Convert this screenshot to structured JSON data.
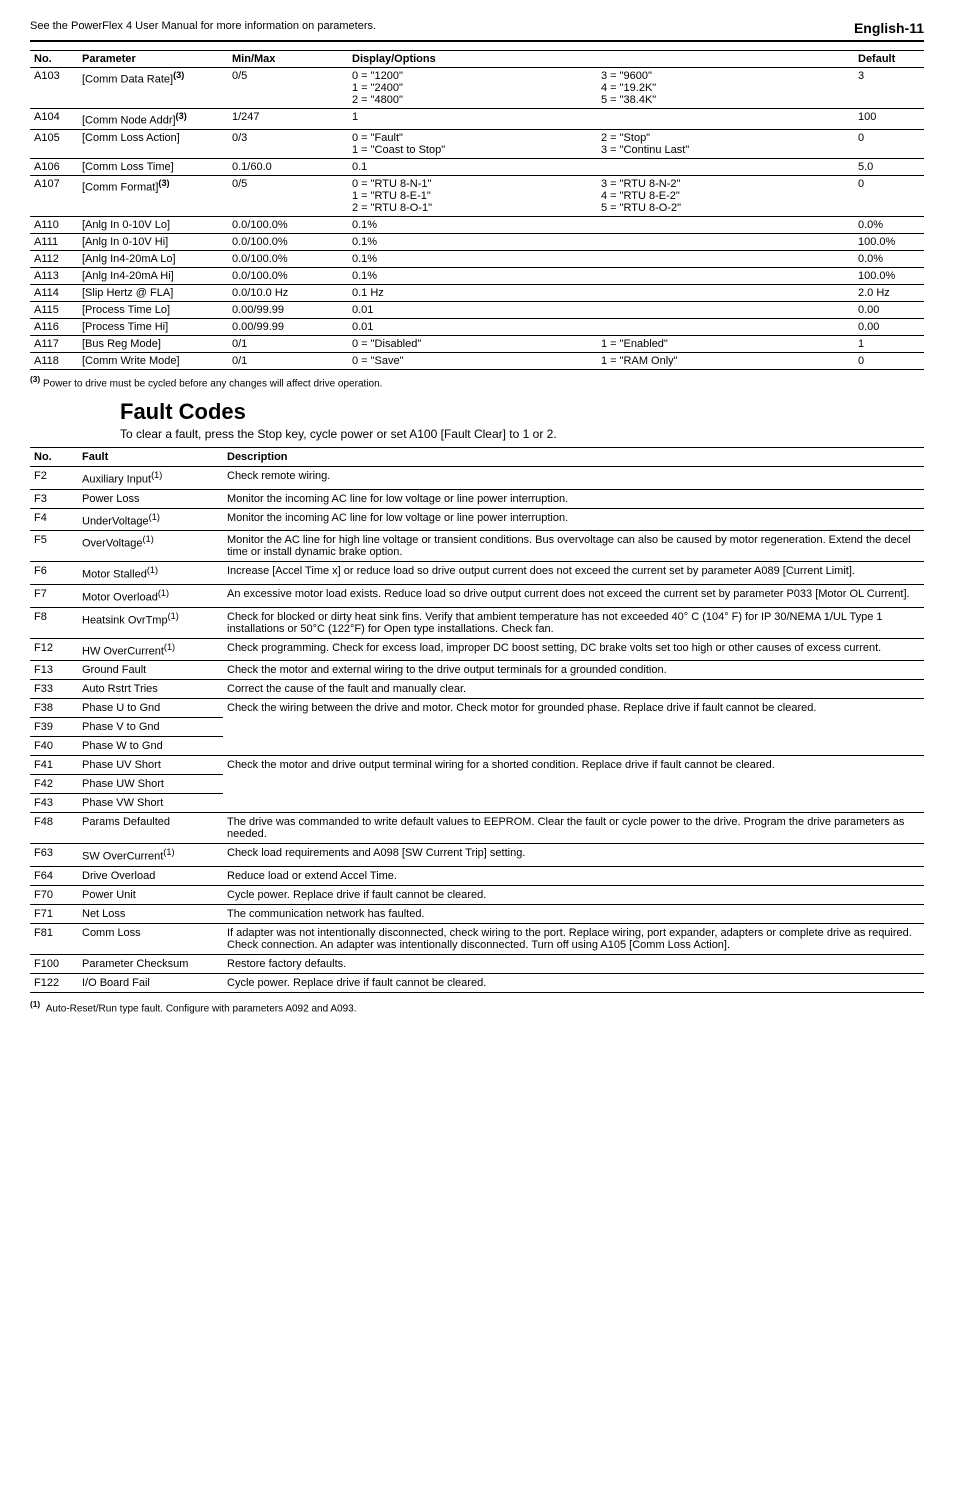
{
  "header": {
    "note": "See the PowerFlex 4 User Manual for more information on parameters.",
    "page": "English-11"
  },
  "param_headers": [
    "No.",
    "Parameter",
    "Min/Max",
    "Display/Options",
    "Default"
  ],
  "params": [
    {
      "no": "A103",
      "name": "[Comm Data Rate]",
      "sup": "(3)",
      "minmax": "0/5",
      "opts1": [
        "0 = \"1200\"",
        "1 = \"2400\"",
        "2 = \"4800\""
      ],
      "opts2": [
        "3 = \"9600\"",
        "4 = \"19.2K\"",
        "5 = \"38.4K\""
      ],
      "def": "3"
    },
    {
      "no": "A104",
      "name": "[Comm Node Addr]",
      "sup": "(3)",
      "minmax": "1/247",
      "opts1": [
        "1"
      ],
      "opts2": [],
      "def": "100"
    },
    {
      "no": "A105",
      "name": "[Comm Loss Action]",
      "sup": "",
      "minmax": "0/3",
      "opts1": [
        "0 = \"Fault\"",
        "1 = \"Coast to Stop\""
      ],
      "opts2": [
        "2 = \"Stop\"",
        "3 = \"Continu Last\""
      ],
      "def": "0"
    },
    {
      "no": "A106",
      "name": "[Comm Loss Time]",
      "sup": "",
      "minmax": "0.1/60.0",
      "opts1": [
        "0.1"
      ],
      "opts2": [],
      "def": "5.0"
    },
    {
      "no": "A107",
      "name": "[Comm Format]",
      "sup": "(3)",
      "minmax": "0/5",
      "opts1": [
        "0 = \"RTU 8-N-1\"",
        "1 = \"RTU 8-E-1\"",
        "2 = \"RTU 8-O-1\""
      ],
      "opts2": [
        "3 = \"RTU 8-N-2\"",
        "4 = \"RTU 8-E-2\"",
        "5 = \"RTU 8-O-2\""
      ],
      "def": "0"
    },
    {
      "no": "A110",
      "name": "[Anlg In 0-10V Lo]",
      "sup": "",
      "minmax": "0.0/100.0%",
      "opts1": [
        "0.1%"
      ],
      "opts2": [],
      "def": "0.0%"
    },
    {
      "no": "A111",
      "name": "[Anlg In 0-10V Hi]",
      "sup": "",
      "minmax": "0.0/100.0%",
      "opts1": [
        "0.1%"
      ],
      "opts2": [],
      "def": "100.0%"
    },
    {
      "no": "A112",
      "name": "[Anlg In4-20mA Lo]",
      "sup": "",
      "minmax": "0.0/100.0%",
      "opts1": [
        "0.1%"
      ],
      "opts2": [],
      "def": "0.0%"
    },
    {
      "no": "A113",
      "name": "[Anlg In4-20mA Hi]",
      "sup": "",
      "minmax": "0.0/100.0%",
      "opts1": [
        "0.1%"
      ],
      "opts2": [],
      "def": "100.0%"
    },
    {
      "no": "A114",
      "name": "[Slip Hertz @ FLA]",
      "sup": "",
      "minmax": "0.0/10.0 Hz",
      "opts1": [
        "0.1 Hz"
      ],
      "opts2": [],
      "def": "2.0 Hz"
    },
    {
      "no": "A115",
      "name": "[Process Time Lo]",
      "sup": "",
      "minmax": "0.00/99.99",
      "opts1": [
        "0.01"
      ],
      "opts2": [],
      "def": "0.00"
    },
    {
      "no": "A116",
      "name": "[Process Time Hi]",
      "sup": "",
      "minmax": "0.00/99.99",
      "opts1": [
        "0.01"
      ],
      "opts2": [],
      "def": "0.00"
    },
    {
      "no": "A117",
      "name": "[Bus Reg Mode]",
      "sup": "",
      "minmax": "0/1",
      "opts1": [
        "0 = \"Disabled\""
      ],
      "opts2": [
        "1 = \"Enabled\""
      ],
      "def": "1"
    },
    {
      "no": "A118",
      "name": "[Comm Write Mode]",
      "sup": "",
      "minmax": "0/1",
      "opts1": [
        "0 = \"Save\""
      ],
      "opts2": [
        "1 = \"RAM Only\""
      ],
      "def": "0"
    }
  ],
  "param_footnote_sup": "(3)",
  "param_footnote": " Power to drive must be cycled before any changes will affect drive operation.",
  "fault_section": {
    "title": "Fault Codes",
    "sub": "To clear a fault, press the Stop key, cycle power or set A100 [Fault Clear] to 1 or 2."
  },
  "fault_headers": [
    "No.",
    "Fault",
    "Description"
  ],
  "faults": [
    {
      "no": "F2",
      "name": "Auxiliary Input",
      "sup": "(1)",
      "desc": "Check remote wiring."
    },
    {
      "no": "F3",
      "name": "Power Loss",
      "sup": "",
      "desc": "Monitor the incoming AC line for low voltage or line power interruption."
    },
    {
      "no": "F4",
      "name": "UnderVoltage",
      "sup": "(1)",
      "desc": "Monitor the incoming AC line for low voltage or line power interruption."
    },
    {
      "no": "F5",
      "name": "OverVoltage",
      "sup": "(1)",
      "desc": "Monitor the AC line for high line voltage or transient conditions. Bus overvoltage can also be caused by motor regeneration. Extend the decel time or install dynamic brake option."
    },
    {
      "no": "F6",
      "name": "Motor Stalled",
      "sup": "(1)",
      "desc": "Increase [Accel Time x] or reduce load so drive output current does not exceed the current set by parameter A089 [Current Limit]."
    },
    {
      "no": "F7",
      "name": "Motor Overload",
      "sup": "(1)",
      "desc": "An excessive motor load exists. Reduce load so drive output current does not exceed the current set by parameter P033 [Motor OL Current]."
    },
    {
      "no": "F8",
      "name": "Heatsink OvrTmp",
      "sup": "(1)",
      "desc": "Check for blocked or dirty heat sink fins. Verify that ambient temperature has not exceeded 40° C (104° F) for IP 30/NEMA 1/UL Type 1 installations or 50°C (122°F) for Open type installations. Check fan."
    },
    {
      "no": "F12",
      "name": "HW OverCurrent",
      "sup": "(1)",
      "desc": "Check programming. Check for excess load, improper DC boost setting, DC brake volts set too high or other causes of excess current."
    },
    {
      "no": "F13",
      "name": "Ground Fault",
      "sup": "",
      "desc": "Check the motor and external wiring to the drive output terminals for a grounded condition."
    },
    {
      "no": "F33",
      "name": "Auto Rstrt Tries",
      "sup": "",
      "desc": "Correct the cause of the fault and manually clear."
    },
    {
      "no": "F38",
      "name": "Phase U to Gnd",
      "sup": "",
      "desc": "Check the wiring between the drive and motor. Check motor for grounded phase. Replace drive if fault cannot be cleared.",
      "rowspan": 3
    },
    {
      "no": "F39",
      "name": "Phase V to Gnd",
      "sup": "",
      "merge": true
    },
    {
      "no": "F40",
      "name": "Phase W to Gnd",
      "sup": "",
      "merge": true
    },
    {
      "no": "F41",
      "name": "Phase UV Short",
      "sup": "",
      "desc": "Check the motor and drive output terminal wiring for a shorted condition. Replace drive if fault cannot be cleared.",
      "rowspan": 3
    },
    {
      "no": "F42",
      "name": "Phase UW Short",
      "sup": "",
      "merge": true
    },
    {
      "no": "F43",
      "name": "Phase VW Short",
      "sup": "",
      "merge": true
    },
    {
      "no": "F48",
      "name": "Params Defaulted",
      "sup": "",
      "desc": "The drive was commanded to write default values to EEPROM. Clear the fault or cycle power to the drive. Program the drive parameters as needed."
    },
    {
      "no": "F63",
      "name": "SW OverCurrent",
      "sup": "(1)",
      "desc": "Check load requirements and A098 [SW Current Trip] setting."
    },
    {
      "no": "F64",
      "name": "Drive Overload",
      "sup": "",
      "desc": "Reduce load or extend Accel Time."
    },
    {
      "no": "F70",
      "name": "Power Unit",
      "sup": "",
      "desc": "Cycle power. Replace drive if fault cannot be cleared."
    },
    {
      "no": "F71",
      "name": "Net Loss",
      "sup": "",
      "desc": "The communication network has faulted."
    },
    {
      "no": "F81",
      "name": "Comm Loss",
      "sup": "",
      "desc": "If adapter was not intentionally disconnected, check wiring to the port. Replace wiring, port expander, adapters or complete drive as required. Check connection. An adapter was intentionally disconnected. Turn off using A105 [Comm Loss Action]."
    },
    {
      "no": "F100",
      "name": "Parameter Checksum",
      "sup": "",
      "desc": "Restore factory defaults."
    },
    {
      "no": "F122",
      "name": "I/O Board Fail",
      "sup": "",
      "desc": "Cycle power. Replace drive if fault cannot be cleared."
    }
  ],
  "fault_footnote_sup": "(1)",
  "fault_footnote": "Auto-Reset/Run type fault. Configure with parameters A092 and A093."
}
